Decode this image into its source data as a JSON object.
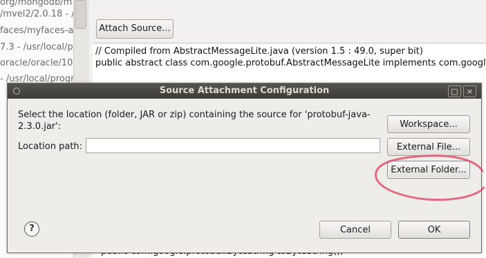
{
  "background": {
    "left_lines": [
      "org/mongodb/m",
      "/mvel2/2.0.18 - /",
      "faces/myfaces-a",
      "7.3 - /usr/local/pr",
      "oracle/oracle/10.",
      "- /usr/local/progr"
    ],
    "attach_source_label": "Attach Source...",
    "code_lines": [
      "// Compiled from AbstractMessageLite.java (version 1.5 : 49.0, super bit)",
      "public abstract class com.google.protobuf.AbstractMessageLite implements com.googl"
    ],
    "bottom_line": "public com.google.protobuf.ByteString toByteString();"
  },
  "dialog": {
    "title": "Source Attachment Configuration",
    "window_buttons": {
      "maximize": "□",
      "close": "×"
    },
    "description": "Select the location (folder, JAR or zip) containing the source for 'protobuf-java-2.3.0.jar':",
    "location_label": "Location path:",
    "location_value": "",
    "buttons": {
      "workspace": "Workspace...",
      "external_file": "External File...",
      "external_folder": "External Folder...",
      "cancel": "Cancel",
      "ok": "OK"
    },
    "help_icon": "?"
  },
  "annotation": {
    "color": "#e0546e"
  }
}
